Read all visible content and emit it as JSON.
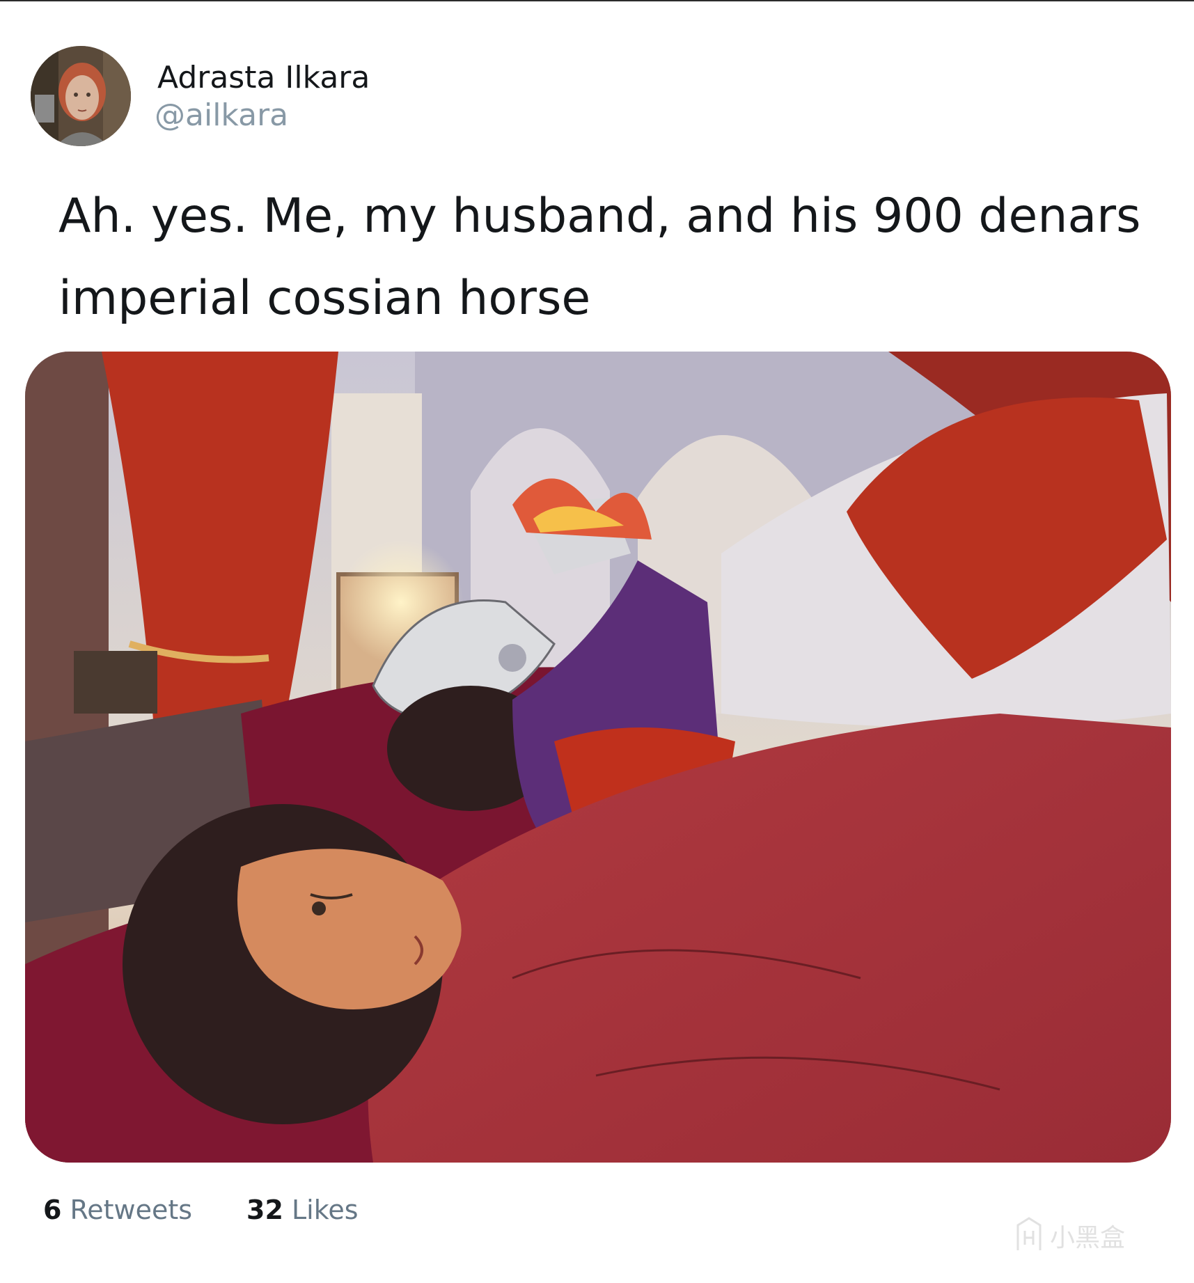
{
  "author": {
    "display_name": "Adrasta Ilkara",
    "handle": "@ailkara"
  },
  "tweet": {
    "text_line1": "Ah. yes. Me, my husband, and his 900 denars",
    "text_line2": "imperial cossian horse"
  },
  "stats": {
    "retweets_count": "6",
    "retweets_label": "Retweets",
    "likes_count": "32",
    "likes_label": "Likes"
  },
  "watermark": {
    "text": "小黑盒"
  },
  "icons": [
    "avatar-portrait",
    "watermark-logo-icon"
  ],
  "colors": {
    "text_primary": "#14171a",
    "text_secondary": "#8899a6",
    "stat_label": "#657786",
    "blanket_red": "#a8333c",
    "curtain_red": "#b8321f"
  }
}
